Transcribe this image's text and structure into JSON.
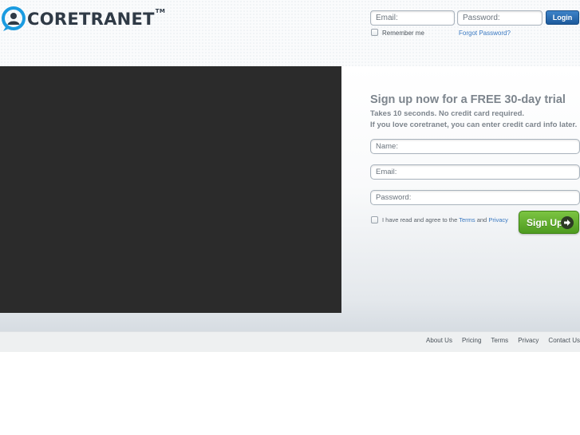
{
  "brand": {
    "name": "CORETRANET",
    "trademark": "TM",
    "color": "#1a9be0"
  },
  "login": {
    "email_placeholder": "Email:",
    "password_placeholder": "Password:",
    "button_label": "Login",
    "remember_label": "Remember me",
    "forgot_label": "Forgot Password?"
  },
  "video": {
    "background": "#2b2b2b"
  },
  "signup": {
    "title": "Sign up now for a FREE 30-day trial",
    "subtitle_1": "Takes 10 seconds. No credit card required.",
    "subtitle_2": "If you love coretranet, you can enter credit card info later.",
    "name_placeholder": "Name:",
    "email_placeholder": "Email:",
    "password_placeholder": "Password:",
    "agree_text": "I have read and agree to the",
    "terms_link": "Terms",
    "and_text": "and",
    "privacy_link": "Privacy",
    "button_label": "Sign Up",
    "button_icon": "arrow-right-icon"
  },
  "footer": {
    "links": [
      "About Us",
      "Pricing",
      "Terms",
      "Privacy",
      "Contact Us"
    ]
  }
}
